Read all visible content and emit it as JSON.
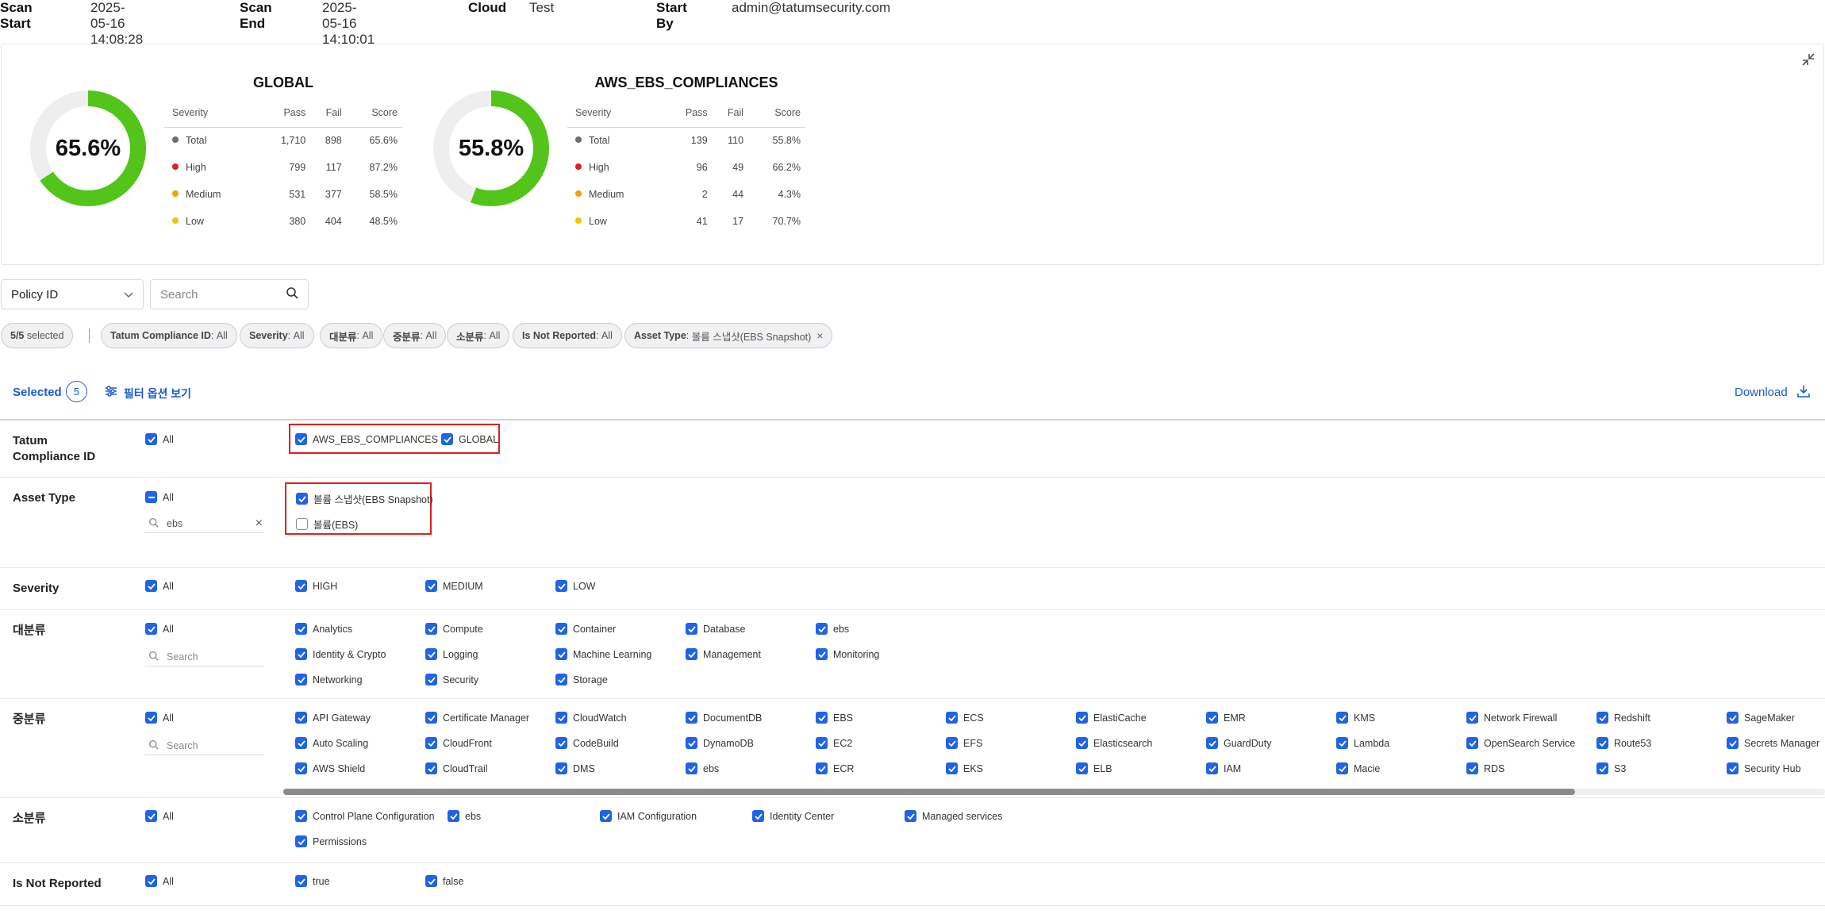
{
  "header": {
    "scan_start_label": "Scan Start",
    "scan_start": "2025-05-16 14:08:28",
    "scan_end_label": "Scan End",
    "scan_end": "2025-05-16 14:10:01",
    "cloud_label": "Cloud",
    "cloud": "Test",
    "start_by_label": "Start By",
    "start_by": "admin@tatumsecurity.com"
  },
  "summary": {
    "columns": [
      "Severity",
      "Pass",
      "Fail",
      "Score"
    ],
    "colors": {
      "total": "#6b6e75",
      "high": "#e02020",
      "medium": "#f5a000",
      "low": "#f5c400",
      "donut_fill": "#52c41a",
      "donut_track": "#eeeeee"
    },
    "global": {
      "title": "GLOBAL",
      "score_text": "65.6%",
      "score": 65.6,
      "rows": [
        {
          "severity": "Total",
          "pass": "1,710",
          "fail": "898",
          "score": "65.6%"
        },
        {
          "severity": "High",
          "pass": "799",
          "fail": "117",
          "score": "87.2%"
        },
        {
          "severity": "Medium",
          "pass": "531",
          "fail": "377",
          "score": "58.5%"
        },
        {
          "severity": "Low",
          "pass": "380",
          "fail": "404",
          "score": "48.5%"
        }
      ]
    },
    "ebs": {
      "title": "AWS_EBS_COMPLIANCES",
      "score_text": "55.8%",
      "score": 55.8,
      "rows": [
        {
          "severity": "Total",
          "pass": "139",
          "fail": "110",
          "score": "55.8%"
        },
        {
          "severity": "High",
          "pass": "96",
          "fail": "49",
          "score": "66.2%"
        },
        {
          "severity": "Medium",
          "pass": "2",
          "fail": "44",
          "score": "4.3%"
        },
        {
          "severity": "Low",
          "pass": "41",
          "fail": "17",
          "score": "70.7%"
        }
      ]
    }
  },
  "search": {
    "select_value": "Policy ID",
    "placeholder": "Search"
  },
  "chips": {
    "selected_count": "5/5",
    "selected_word": "selected",
    "tatum_key": "Tatum Compliance ID",
    "tatum_val": "All",
    "severity_key": "Severity",
    "severity_val": "All",
    "major_key": "대분류",
    "major_val": "All",
    "middle_key": "중분류",
    "middle_val": "All",
    "minor_key": "소분류",
    "minor_val": "All",
    "notrep_key": "Is Not Reported",
    "notrep_val": "All",
    "asset_key": "Asset Type",
    "asset_val": "볼륨 스냅샷(EBS Snapshot)"
  },
  "selbar": {
    "selected_label": "Selected",
    "selected_count": "5",
    "filter_toggle": "필터 옵션 보기",
    "download": "Download"
  },
  "filters": {
    "all_label": "All",
    "search_placeholder": "Search",
    "tatum": {
      "label1": "Tatum",
      "label2": "Compliance ID",
      "options": [
        "AWS_EBS_COMPLIANCES",
        "GLOBAL"
      ]
    },
    "asset": {
      "label": "Asset Type",
      "search_value": "ebs",
      "options": [
        {
          "text": "볼륨 스냅샷(EBS Snapshot)",
          "checked": true
        },
        {
          "text": "볼륨(EBS)",
          "checked": false
        }
      ]
    },
    "severity": {
      "label": "Severity",
      "options": [
        "HIGH",
        "MEDIUM",
        "LOW"
      ]
    },
    "major": {
      "label": "대분류",
      "options": [
        "Analytics",
        "Compute",
        "Container",
        "Database",
        "ebs",
        "Identity & Crypto",
        "Logging",
        "Machine Learning",
        "Management",
        "Monitoring",
        "Networking",
        "Security",
        "Storage"
      ]
    },
    "middle": {
      "label": "중분류",
      "options": [
        "API Gateway",
        "Certificate Manager",
        "CloudWatch",
        "DocumentDB",
        "EBS",
        "ECS",
        "ElastiCache",
        "EMR",
        "KMS",
        "Network Firewall",
        "Redshift",
        "SageMaker",
        "Auto Scaling",
        "CloudFront",
        "CodeBuild",
        "DynamoDB",
        "EC2",
        "EFS",
        "Elasticsearch",
        "GuardDuty",
        "Lambda",
        "OpenSearch Service",
        "Route53",
        "Secrets Manager",
        "AWS Shield",
        "CloudTrail",
        "DMS",
        "ebs",
        "ECR",
        "EKS",
        "ELB",
        "IAM",
        "Macie",
        "RDS",
        "S3",
        "Security Hub"
      ]
    },
    "minor": {
      "label": "소분류",
      "options": [
        "Control Plane Configuration",
        "ebs",
        "IAM Configuration",
        "Identity Center",
        "Managed services",
        "Permissions"
      ]
    },
    "notrep": {
      "label": "Is Not Reported",
      "options": [
        "true",
        "false"
      ]
    }
  }
}
